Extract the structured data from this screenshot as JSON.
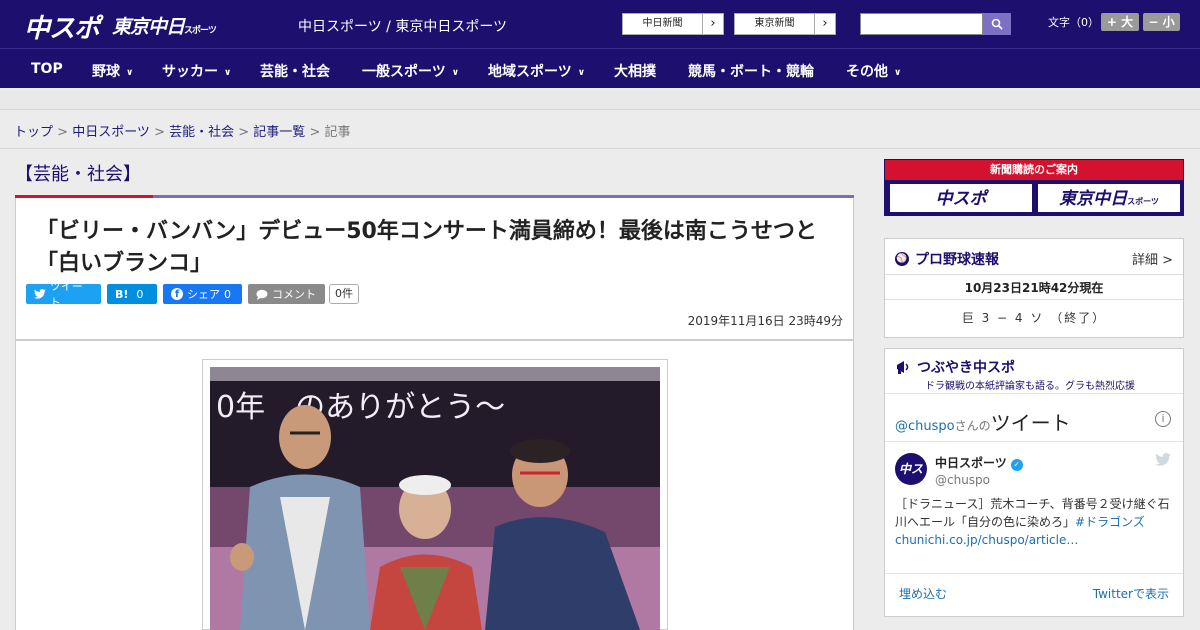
{
  "header": {
    "logo_chuspo": "中スポ",
    "logo_tokyo": "東京中日",
    "logo_tokyo_small": "スポーツ",
    "tagline": "中日スポーツ / 東京中日スポーツ",
    "btn_chunichi": "中日新聞",
    "btn_tokyo": "東京新聞",
    "search_placeholder": "",
    "fontsize_label": "文字（0）",
    "font_bigger": "+ 大",
    "font_smaller": "− 小"
  },
  "nav": [
    "TOP",
    "野球",
    "サッカー",
    "芸能・社会",
    "一般スポーツ",
    "地域スポーツ",
    "大相撲",
    "競馬・ボート・競輪",
    "その他"
  ],
  "breadcrumb": {
    "top": "トップ",
    "chunichi": "中日スポーツ",
    "category": "芸能・社会",
    "list": "記事一覧",
    "current": "記事",
    "sep": " > "
  },
  "article": {
    "category_heading": "【芸能・社会】",
    "title_line1": "「ビリー・バンバン」デビュー50年コンサート満員締め！最後は南こうせつと",
    "title_line2": "「白いブランコ」",
    "tweet_label": "ツイート",
    "hatena_label": "B!",
    "hatena_count": "0",
    "share_label": "シェア",
    "share_count": "0",
    "comment_label": "コメント",
    "comment_count": "0件",
    "date": "2019年11月16日 23時49分",
    "photo_banner": "0年　のありがとう〜"
  },
  "sidebar": {
    "subscribe_title": "新聞購読のご案内",
    "subscribe_logo1": "中スポ",
    "subscribe_logo2": "東京中日",
    "subscribe_logo2_small": "スポーツ",
    "baseball_title": "プロ野球速報",
    "baseball_more": "詳細 >",
    "baseball_date": "10月23日21時42分現在",
    "baseball_score": "巨 3 − 4 ソ （終了）",
    "tweet_title": "つぶやき中スポ",
    "tweet_sub": "ドラ観戦の本紙評論家も語る。グラも熱烈応援",
    "tweet_by_user": "@chuspo",
    "tweet_by_suffix": "さんの",
    "tweet_by_big": "ツイート",
    "tweet_name": "中日スポーツ",
    "tweet_handle": "@chuspo",
    "tweet_text": "［ドラニュース］荒木コーチ、背番号２受け継ぐ石川へエール「自分の色に染めろ」",
    "tweet_tag": "#ドラゴンズ",
    "tweet_link": "chunichi.co.jp/chuspo/article…",
    "tweet_embed": "埋め込む",
    "tweet_view": "Twitterで表示"
  },
  "colors": {
    "brand": "#1c0f6e",
    "accent_red": "#d4112f",
    "twitter": "#1da1f2",
    "facebook": "#1877f2"
  }
}
